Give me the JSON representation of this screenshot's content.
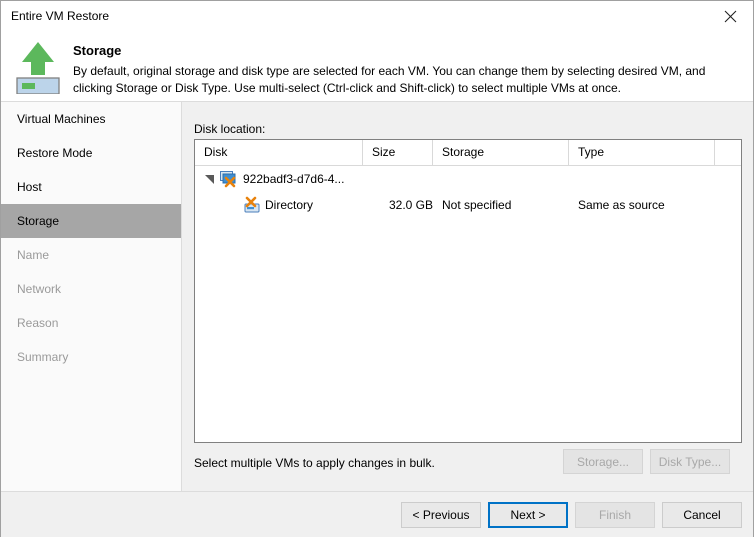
{
  "window": {
    "title": "Entire VM Restore",
    "close_icon": "close-icon"
  },
  "header": {
    "icon": "vm-upload-arrow-icon",
    "title": "Storage",
    "description": "By default, original storage and disk type are selected for each VM. You can change them by selecting desired VM, and clicking Storage or Disk Type. Use multi-select (Ctrl-click and Shift-click) to select multiple VMs at once."
  },
  "sidebar": {
    "items": [
      {
        "label": "Virtual Machines",
        "state": "enabled"
      },
      {
        "label": "Restore Mode",
        "state": "enabled"
      },
      {
        "label": "Host",
        "state": "enabled"
      },
      {
        "label": "Storage",
        "state": "selected"
      },
      {
        "label": "Name",
        "state": "disabled"
      },
      {
        "label": "Network",
        "state": "disabled"
      },
      {
        "label": "Reason",
        "state": "disabled"
      },
      {
        "label": "Summary",
        "state": "disabled"
      }
    ]
  },
  "main": {
    "disk_location_label": "Disk location:",
    "table": {
      "columns": [
        "Disk",
        "Size",
        "Storage",
        "Type"
      ],
      "rows": [
        {
          "icon": "vm-disabled-icon",
          "disk": "922badf3-d7d6-4...",
          "size": "",
          "storage": "",
          "type": "",
          "level": 0,
          "expanded": true
        },
        {
          "icon": "disk-disabled-icon",
          "disk": "Directory",
          "size": "32.0 GB",
          "storage": "Not specified",
          "type": "Same as source",
          "level": 1,
          "expanded": false
        }
      ]
    },
    "bulk_note": "Select multiple VMs to apply changes in bulk.",
    "storage_button": "Storage...",
    "disk_type_button": "Disk Type..."
  },
  "footer": {
    "previous": "< Previous",
    "next": "Next >",
    "finish": "Finish",
    "cancel": "Cancel"
  },
  "colors": {
    "accent": "#0072c6",
    "arrow_green": "#5cb85c",
    "panel": "#f0f0f0",
    "selection": "#a6a6a6",
    "disabled_text": "#9a9a9a",
    "icon_orange": "#e8820c"
  }
}
